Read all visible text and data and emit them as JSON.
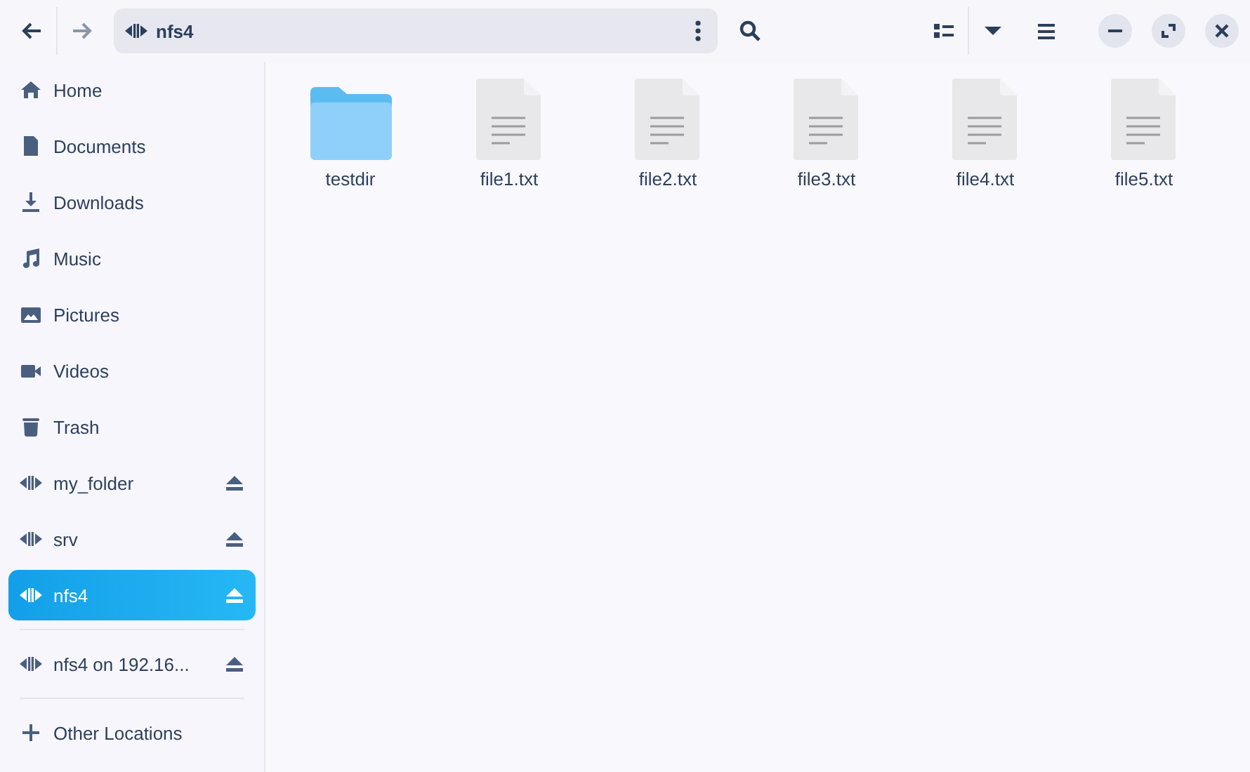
{
  "path_bar": {
    "location": "nfs4",
    "back_disabled": false,
    "forward_disabled": true
  },
  "sidebar": {
    "items": [
      {
        "kind": "home",
        "label": "Home",
        "selected": false
      },
      {
        "kind": "documents",
        "label": "Documents",
        "selected": false
      },
      {
        "kind": "downloads",
        "label": "Downloads",
        "selected": false
      },
      {
        "kind": "music",
        "label": "Music",
        "selected": false
      },
      {
        "kind": "pictures",
        "label": "Pictures",
        "selected": false
      },
      {
        "kind": "videos",
        "label": "Videos",
        "selected": false
      },
      {
        "kind": "trash",
        "label": "Trash",
        "selected": false
      },
      {
        "kind": "mount",
        "label": "my_folder",
        "selected": false
      },
      {
        "kind": "mount",
        "label": "srv",
        "selected": false
      },
      {
        "kind": "mount",
        "label": "nfs4",
        "selected": true
      },
      {
        "kind": "separator"
      },
      {
        "kind": "mount",
        "label": "nfs4 on 192.16...",
        "selected": false
      },
      {
        "kind": "separator"
      },
      {
        "kind": "add",
        "label": "Other Locations",
        "selected": false
      }
    ]
  },
  "files": [
    {
      "kind": "folder",
      "name": "testdir"
    },
    {
      "kind": "text",
      "name": "file1.txt"
    },
    {
      "kind": "text",
      "name": "file2.txt"
    },
    {
      "kind": "text",
      "name": "file3.txt"
    },
    {
      "kind": "text",
      "name": "file4.txt"
    },
    {
      "kind": "text",
      "name": "file5.txt"
    }
  ]
}
